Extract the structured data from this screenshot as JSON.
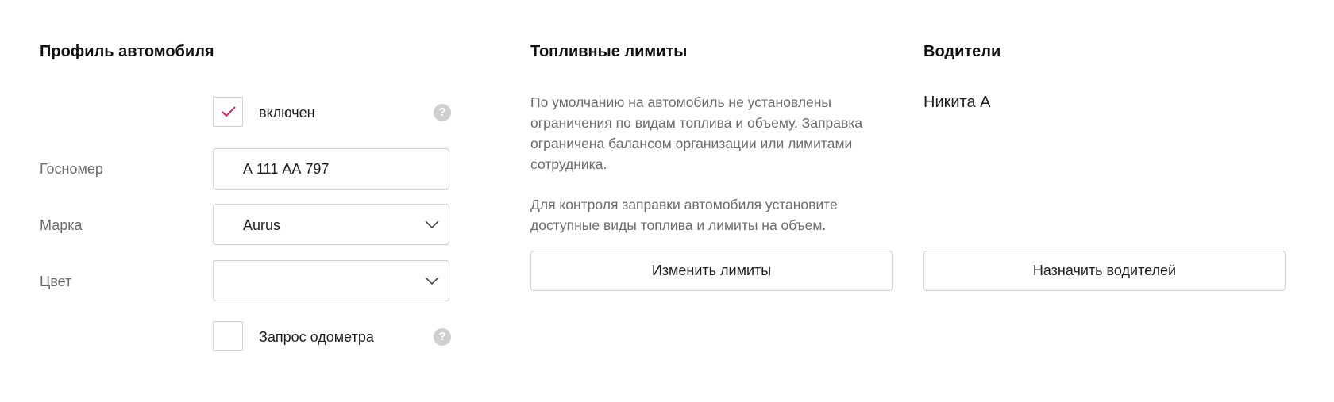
{
  "profile": {
    "title": "Профиль автомобиля",
    "enabled": {
      "label": "включен",
      "checked": true,
      "help_icon": "question-circle-icon"
    },
    "plate": {
      "label": "Госномер",
      "value": "А 111 АА 797"
    },
    "brand": {
      "label": "Марка",
      "value": "Aurus"
    },
    "color": {
      "label": "Цвет",
      "value": ""
    },
    "odometer": {
      "label": "Запрос одометра",
      "checked": false,
      "help_icon": "question-circle-icon"
    }
  },
  "fuel_limits": {
    "title": "Топливные лимиты",
    "description_1": "По умолчанию на автомобиль не установлены ограничения по видам топлива и объему. Заправка ограничена балансом организации или лимитами сотрудника.",
    "description_2": "Для контроля заправки автомобиля установите доступные виды топлива и лимиты на объем.",
    "button_label": "Изменить лимиты"
  },
  "drivers": {
    "title": "Водители",
    "items": [
      "Никита А"
    ],
    "button_label": "Назначить водителей"
  },
  "colors": {
    "accent": "#e4235f",
    "border": "#cfcfcf",
    "muted_text": "#6b6b6b",
    "help_icon_bg": "#cfcfcf"
  }
}
